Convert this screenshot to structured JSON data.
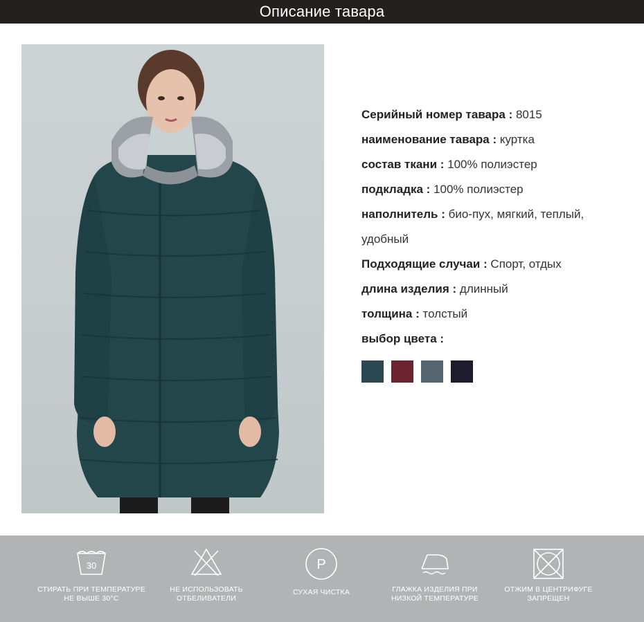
{
  "header": {
    "title": "Описание тавара"
  },
  "specs": [
    {
      "label": "Серийный номер тавара :",
      "value": " 8015"
    },
    {
      "label": "наименование тавара :",
      "value": " куртка"
    },
    {
      "label": "состав ткани :",
      "value": " 100% полиэстер"
    },
    {
      "label": "подкладка :",
      "value": " 100% полиэстер"
    },
    {
      "label": "наполнитель :",
      "value": " био-пух, мягкий, теплый, удобный"
    },
    {
      "label": "Подходящие случаи :",
      "value": " Спорт, отдых"
    },
    {
      "label": "длина изделия :",
      "value": " длинный"
    },
    {
      "label": "толщина :",
      "value": " толстый"
    },
    {
      "label": "выбор цвета :",
      "value": ""
    }
  ],
  "color_options": [
    "#2c4850",
    "#6b2430",
    "#566670",
    "#1d1c2c"
  ],
  "care": [
    {
      "icon": "wash-30-icon",
      "line1": "СТИРАТЬ ПРИ ТЕМПЕРАТУРЕ",
      "line2": "НЕ ВЫШЕ 30°C",
      "wash_temp": "30"
    },
    {
      "icon": "no-bleach-icon",
      "line1": "НЕ ИСПОЛЬЗОВАТЬ",
      "line2": "ОТБЕЛИВАТЕЛИ"
    },
    {
      "icon": "dry-clean-icon",
      "line1": "СУХАЯ ЧИСТКА",
      "line2": "",
      "symbol": "P"
    },
    {
      "icon": "low-iron-icon",
      "line1": "ГЛАЖКА ИЗДЕЛИЯ ПРИ",
      "line2": "НИЗКОЙ ТЕМПЕРАТУРЕ"
    },
    {
      "icon": "no-tumble-dry-icon",
      "line1": "ОТЖИМ В ЦЕНТРИФУГЕ",
      "line2": "ЗАПРЕЩЕН"
    }
  ],
  "colors": {
    "header_bg": "#231f1e",
    "care_bg": "#b2b3b5",
    "jacket": "#23464b"
  }
}
